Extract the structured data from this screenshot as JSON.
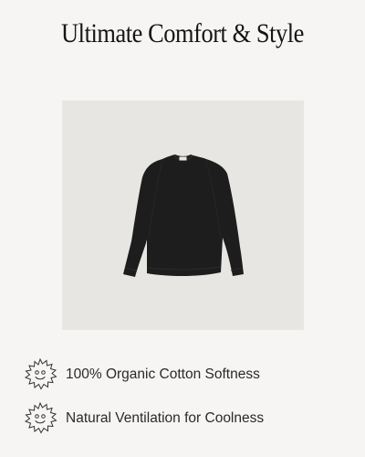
{
  "page": {
    "title": "Ultimate Comfort & Style"
  },
  "product_image": {
    "subject": "black long-sleeve crewneck sweatshirt",
    "panel_color": "#e8e6e3",
    "garment_color": "#1d1d1d"
  },
  "features": [
    {
      "icon": "smiling-sun-icon",
      "label": "100% Organic Cotton Softness"
    },
    {
      "icon": "smiling-sun-icon",
      "label": "Natural Ventilation for Coolness"
    }
  ],
  "colors": {
    "background": "#f6f5f3",
    "text": "#1c1c1c"
  }
}
